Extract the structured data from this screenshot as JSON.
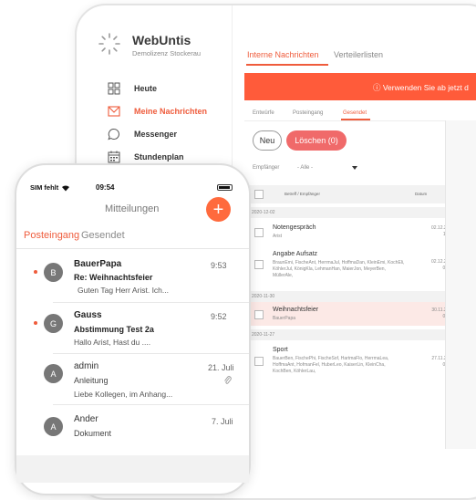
{
  "tablet": {
    "logo": {
      "title": "WebUntis",
      "subtitle": "Demolizenz Stockerau"
    },
    "sidebar": [
      {
        "label": "Heute",
        "icon": "dashboard-icon",
        "active": false
      },
      {
        "label": "Meine Nachrichten",
        "icon": "mail-icon",
        "active": true
      },
      {
        "label": "Messenger",
        "icon": "chat-bubble-icon",
        "active": false
      },
      {
        "label": "Stundenplan",
        "icon": "calendar-icon",
        "active": false
      }
    ],
    "tabs": [
      "Interne Nachrichten",
      "Verteilerlisten"
    ],
    "banner": "ⓘ Verwenden Sie ab jetzt d",
    "subtabs": [
      "Entwürfe",
      "Posteingang",
      "Gesendet"
    ],
    "buttons": {
      "new": "Neu",
      "delete": "Löschen (0)"
    },
    "filter": {
      "label": "Empfänger",
      "value": "- Alle -"
    },
    "columns": {
      "subject": "Betreff / Empfänger",
      "date": "Datum"
    },
    "groups": [
      {
        "date": "2020-12-02",
        "messages": [
          {
            "title": "Notengespräch",
            "recipients": "Arist",
            "date": "02.12.2020",
            "time": "11:41"
          },
          {
            "title": "Angabe Aufsatz",
            "recipients": "BraunEmi, FischeAnt, HerrmaJul, HoffmaDan, KleinEmi, KochEli, KöhlerJul, KönigKla, LehmanHan, MaierJon, MeyerBen, MüllerAle,",
            "date": "02.12.2020",
            "time": "09:56"
          }
        ]
      },
      {
        "date": "2020-11-30",
        "messages": [
          {
            "title": "Weihnachtsfeier",
            "recipients": "BauerPapa",
            "date": "30.11.2020",
            "time": "09:25"
          }
        ]
      },
      {
        "date": "2020-11-27",
        "messages": [
          {
            "title": "Sport",
            "recipients": "BauerBen, FischePhi, FischeSof, HartmaFlo, HerrmaLea, HoffmaAnt, HofmanFel, HuberLeo, KaiserLin, KleinCha, KochBen, KöhlerLau,",
            "date": "27.11.2020",
            "time": "09:42"
          }
        ]
      }
    ]
  },
  "phone": {
    "status": {
      "carrier": "SIM fehlt",
      "time": "09:54"
    },
    "title": "Mitteilungen",
    "add_label": "+",
    "tabs": [
      "Posteingang",
      "Gesendet"
    ],
    "messages": [
      {
        "initial": "B",
        "sender": "BauerPapa",
        "time": "9:53",
        "subject": "Re: Weihnachtsfeier",
        "preview": "Guten Tag Herr Arist.  Ich...",
        "unread": true
      },
      {
        "initial": "G",
        "sender": "Gauss",
        "time": "9:52",
        "subject": "Abstimmung Test 2a",
        "preview": "Hallo Arist, Hast du ....",
        "unread": true
      },
      {
        "initial": "A",
        "sender": "admin",
        "time": "21. Juli",
        "subject": "Anleitung",
        "preview": "Liebe Kollegen, im Anhang...",
        "unread": false,
        "attachment": true
      },
      {
        "initial": "A",
        "sender": "Ander",
        "time": "7. Juli",
        "subject": "Dokument",
        "preview": "",
        "unread": false
      }
    ]
  }
}
